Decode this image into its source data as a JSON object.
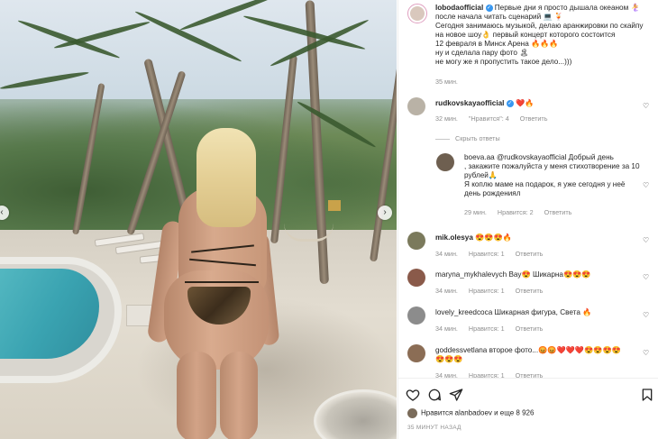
{
  "post": {
    "author": "lobodaofficial",
    "caption_line1": "Первые дни я просто дышала океаном 🧜‍♀️",
    "caption_line2": "после начала читать сценарий 💻 🍹",
    "caption_line3": "Сегодня занимаюсь музыкой, делаю аранжировки по скайпу",
    "caption_line4": "на новое шоу👌 первый концерт которого состоится",
    "caption_line5": "12 февраля в Минск Арена 🔥🔥🔥",
    "caption_line6": "ну и сделала пару фото 🏝",
    "caption_line7": "не могу же я пропустить такое дело...)))",
    "time": "35 мин."
  },
  "comments": [
    {
      "user": "rudkovskayaofficial",
      "text": "❤️🔥",
      "time": "32 мин.",
      "likes": "\"Нравится\": 4",
      "reply": "Ответить",
      "avatar_color": "#b9b2a6"
    },
    {
      "hide_replies": "Скрыть ответы"
    },
    {
      "user": "boeva.aa",
      "line1": "@rudkovskayaofficial Добрый день",
      "line2": ", закажите пожалуйста у меня стихотворение за 10",
      "line3": "рублей🙏",
      "line4": "Я коплю маме на подарок, я уже сегодня у неё",
      "line5": "день рождениял",
      "time": "29 мин.",
      "likes": "Нравится: 2",
      "reply": "Ответить",
      "avatar_color": "#6e5f50"
    },
    {
      "user": "mik.olesya",
      "text": "😍😍😍🔥",
      "time": "34 мин.",
      "likes": "Нравится: 1",
      "reply": "Ответить",
      "avatar_color": "#7b7a5c"
    },
    {
      "user": "maryna_mykhalevych",
      "text": "Вау😍 Шикарна😍😍😍",
      "time": "34 мин.",
      "likes": "Нравится: 1",
      "reply": "Ответить",
      "avatar_color": "#8a5a4a"
    },
    {
      "user": "lovely_kreedcoca",
      "text": "Шикарная фигура, Света 🔥",
      "time": "34 мин.",
      "likes": "Нравится: 1",
      "reply": "Ответить",
      "avatar_color": "#8c8c8c"
    },
    {
      "user": "goddessvetlana",
      "line1": "второе фото...😡😡❤️❤️❤️😍😍😍😍",
      "line2": "😍😍😍",
      "time": "34 мин.",
      "likes": "Нравится: 1",
      "reply": "Ответить",
      "avatar_color": "#8b6d55"
    }
  ],
  "footer": {
    "likes_text": "Нравится alanbadoev и еще 8 926",
    "timestamp": "35 МИНУТ НАЗАД"
  },
  "nav": {
    "prev": "‹",
    "next": "›"
  },
  "colors": {
    "verified": "#3897f0",
    "muted": "#8e8e8e",
    "text": "#262626"
  }
}
